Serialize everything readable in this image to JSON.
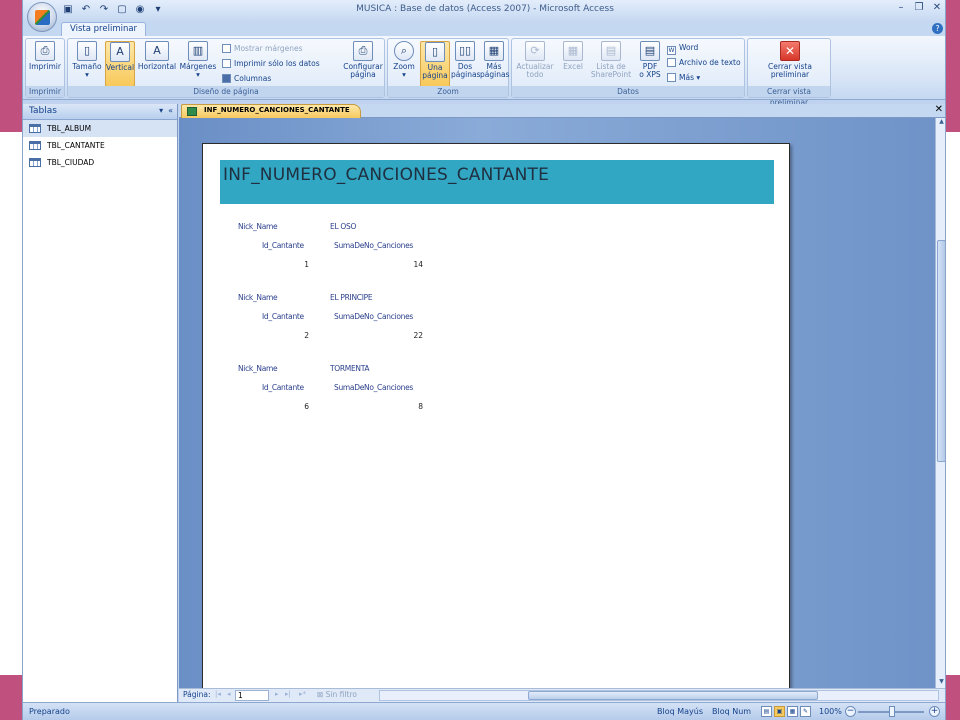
{
  "window": {
    "title": "MUSICA : Base de datos (Access 2007) - Microsoft Access"
  },
  "ribbon": {
    "tab": "Vista preliminar",
    "groups": {
      "imprimir": {
        "label": "Imprimir",
        "print": "Imprimir"
      },
      "diseno": {
        "label": "Diseño de página",
        "tamano": "Tamaño",
        "vertical": "Vertical",
        "horizontal": "Horizontal",
        "margenes": "Márgenes",
        "mostrar_margenes": "Mostrar márgenes",
        "imprimir_solo": "Imprimir sólo los datos",
        "columnas": "Columnas",
        "configurar": "Configurar",
        "pagina": "página"
      },
      "zoom": {
        "label": "Zoom",
        "zoom": "Zoom",
        "una": "Una",
        "una2": "página",
        "dos": "Dos",
        "dos2": "páginas",
        "mas": "Más",
        "mas2": "páginas"
      },
      "datos": {
        "label": "Datos",
        "actualizar": "Actualizar",
        "todo": "todo",
        "excel": "Excel",
        "lista": "Lista de",
        "sharepoint": "SharePoint",
        "pdf": "PDF",
        "xps": "o XPS",
        "word": "Word",
        "archivo": "Archivo de texto",
        "mas": "Más"
      },
      "cerrar": {
        "label": "Cerrar vista preliminar",
        "line1": "Cerrar vista",
        "line2": "preliminar"
      }
    }
  },
  "nav": {
    "header": "Tablas",
    "items": [
      "TBL_ALBUM",
      "TBL_CANTANTE",
      "TBL_CIUDAD"
    ]
  },
  "document": {
    "tab": "INF_NUMERO_CANCIONES_CANTANTE",
    "report_title": "INF_NUMERO_CANCIONES_CANTANTE",
    "labels": {
      "nick": "Nick_Name",
      "id": "Id_Cantante",
      "suma": "SumaDeNo_Canciones"
    },
    "records": [
      {
        "nick": "EL OSO",
        "id": "1",
        "suma": "14"
      },
      {
        "nick": "EL PRINCIPE",
        "id": "2",
        "suma": "22"
      },
      {
        "nick": "TORMENTA",
        "id": "6",
        "suma": "8"
      }
    ]
  },
  "pagebar": {
    "label": "Página:",
    "page": "1",
    "filter": "Sin filtro"
  },
  "status": {
    "left": "Preparado",
    "caps": "Bloq Mayús",
    "num": "Bloq Num",
    "zoom": "100%"
  }
}
